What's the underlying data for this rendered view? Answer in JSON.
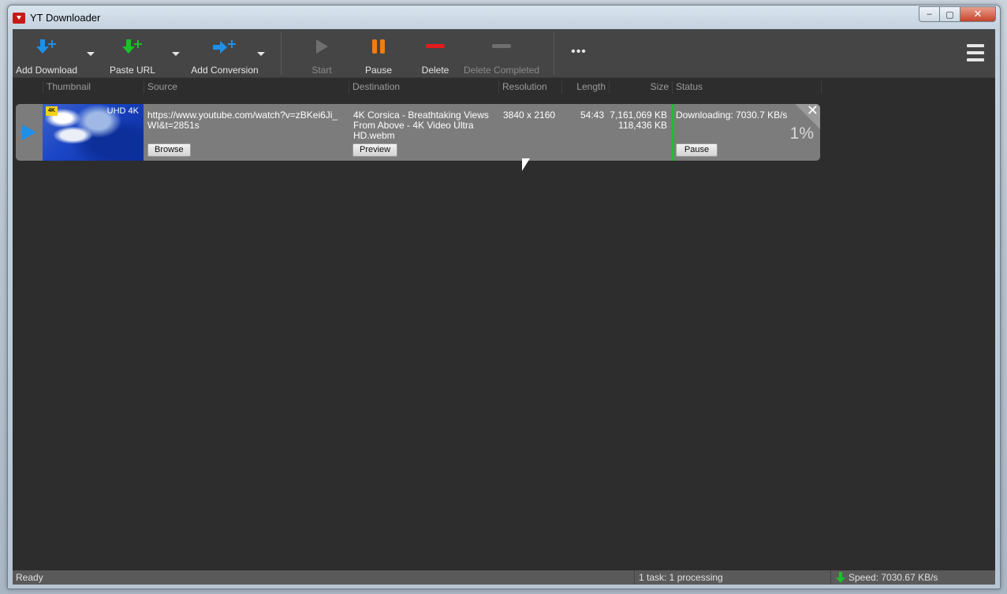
{
  "window": {
    "title": "YT Downloader",
    "controls": {
      "minimize": "‒",
      "maximize": "▢",
      "close": "✕"
    }
  },
  "toolbar": {
    "add_download": "Add Download",
    "paste_url": "Paste URL",
    "add_conversion": "Add Conversion",
    "start": "Start",
    "pause": "Pause",
    "delete": "Delete",
    "delete_completed": "Delete Completed",
    "more": "•••",
    "colors": {
      "blue": "#1e90e8",
      "green": "#1cbf2a",
      "orange": "#f07d11",
      "red": "#e41b1b"
    }
  },
  "columns": {
    "thumbnail": "Thumbnail",
    "source": "Source",
    "destination": "Destination",
    "resolution": "Resolution",
    "length": "Length",
    "size": "Size",
    "status": "Status"
  },
  "downloads": [
    {
      "thumb_badge": "4K",
      "thumb_label": "UHD 4K",
      "source": "https://www.youtube.com/watch?v=zBKei6Ji_WI&t=2851s",
      "browse_label": "Browse",
      "destination": "4K Corsica - Breathtaking Views From Above - 4K Video Ultra HD.webm",
      "preview_label": "Preview",
      "resolution": "3840 x 2160",
      "length": "54:43",
      "size_total": "7,161,069 KB",
      "size_done": "118,436 KB",
      "status": "Downloading: 7030.7 KB/s",
      "pause_label": "Pause",
      "progress_text": "1%",
      "progress": 0.01
    }
  ],
  "statusbar": {
    "state": "Ready",
    "tasks": "1 task: 1 processing",
    "speed": "Speed: 7030.67 KB/s"
  }
}
